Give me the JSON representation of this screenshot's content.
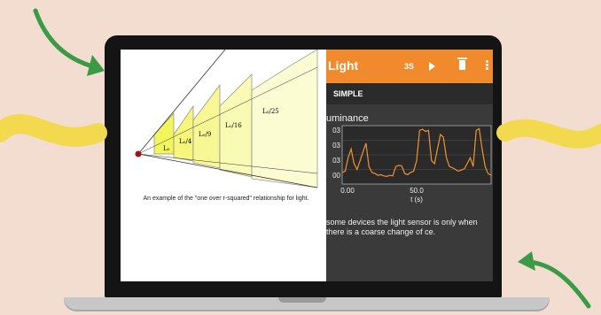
{
  "figure": {
    "labels": [
      "L₀",
      "L₀/4",
      "L₀/9",
      "L₀/16",
      "L₀/25"
    ],
    "caption": "An example of the \"one over r-squared\" relationship for light."
  },
  "app": {
    "title": "Light",
    "timer": "3S",
    "tab": "SIMPLE",
    "section": "uminance",
    "note": "some devices the light sensor is only when there is a coarse change of ce.",
    "colors": {
      "header": "#f08a2c",
      "trace": "#f0932e"
    }
  },
  "chart_data": {
    "type": "line",
    "xlabel": "t (s)",
    "x_ticks": [
      "0.00",
      "50.0"
    ],
    "y_ticks": [
      "03",
      "03",
      "03",
      "00"
    ],
    "x": [
      0,
      2,
      4,
      6,
      8,
      10,
      12,
      14,
      16,
      18,
      20,
      22,
      24,
      26,
      28,
      30,
      32,
      34,
      36,
      38,
      40,
      42,
      44,
      46,
      48,
      50,
      52,
      54,
      56,
      58,
      60,
      62,
      64,
      66,
      68,
      70,
      72,
      74,
      76,
      78,
      80,
      82,
      84,
      86,
      88,
      90,
      92,
      94,
      96,
      98,
      100
    ],
    "values": [
      20,
      22,
      45,
      60,
      35,
      25,
      40,
      55,
      70,
      30,
      20,
      18,
      15,
      16,
      14,
      13,
      15,
      14,
      30,
      32,
      31,
      18,
      16,
      20,
      22,
      40,
      92,
      94,
      90,
      92,
      40,
      35,
      60,
      85,
      80,
      45,
      30,
      28,
      25,
      22,
      24,
      26,
      35,
      45,
      30,
      92,
      95,
      60,
      30,
      18,
      15
    ],
    "xlim": [
      0,
      100
    ],
    "ylim": [
      0,
      100
    ],
    "grid": true
  }
}
